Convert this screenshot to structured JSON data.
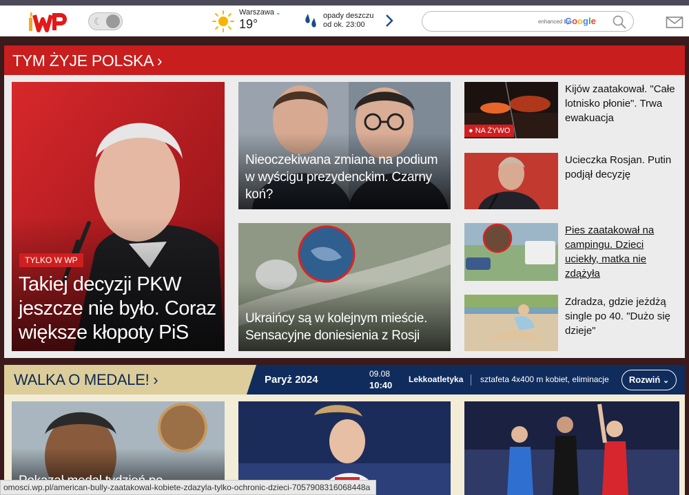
{
  "header": {
    "weather": {
      "city": "Warszawa",
      "temp": "19°"
    },
    "rain": {
      "line1": "opady deszczu",
      "line2": "od ok. 23:00"
    },
    "search": {
      "placeholder": "",
      "enhanced_by": "enhanced by",
      "google": [
        "G",
        "o",
        "o",
        "g",
        "l",
        "e"
      ]
    }
  },
  "section1": {
    "title": "TYM ŻYJE POLSKA ›",
    "main": {
      "badge": "TYLKO W WP",
      "title": "Takiej decyzji PKW jeszcze nie było. Coraz większe kłopoty PiS"
    },
    "mid": [
      {
        "title": "Nieoczekiwana zmiana na podium w wyścigu prezydenckim. Czarny koń?"
      },
      {
        "title": "Ukraińcy są w kolejnym mieście. Sensacyjne doniesienia z Rosji"
      }
    ],
    "side": [
      {
        "badge": "● NA ŻYWO",
        "title": "Kijów zaatakował. \"Całe lotnisko płonie\". Trwa ewakuacja"
      },
      {
        "title": "Ucieczka Rosjan. Putin podjął decyzję"
      },
      {
        "title": "Pies zaatakował na campingu. Dzieci uciekły, matka nie zdążyła"
      },
      {
        "title": "Zdradza, gdzie jeżdżą single po 40. \"Dużo się dzieje\""
      }
    ]
  },
  "section2": {
    "title": "WALKA O MEDALE! ›",
    "event": "Paryż 2024",
    "date": "09.08",
    "time": "10:40",
    "discipline": "Lekkoatletyka",
    "competition": "sztafeta 4x400 m kobiet, eliminacje",
    "expand": "Rozwiń",
    "cards": [
      {
        "title": "Pokazał medal tydzień po"
      },
      {
        "title": ""
      },
      {
        "title": ""
      }
    ]
  },
  "status_url": "omosci.wp.pl/american-bully-zaatakowal-kobiete-zdazyla-tylko-ochronic-dzieci-7057908316068448a",
  "colors": {
    "wp_red": "#c91e1e",
    "navy": "#102c5c",
    "gold": "#dccd9a"
  }
}
